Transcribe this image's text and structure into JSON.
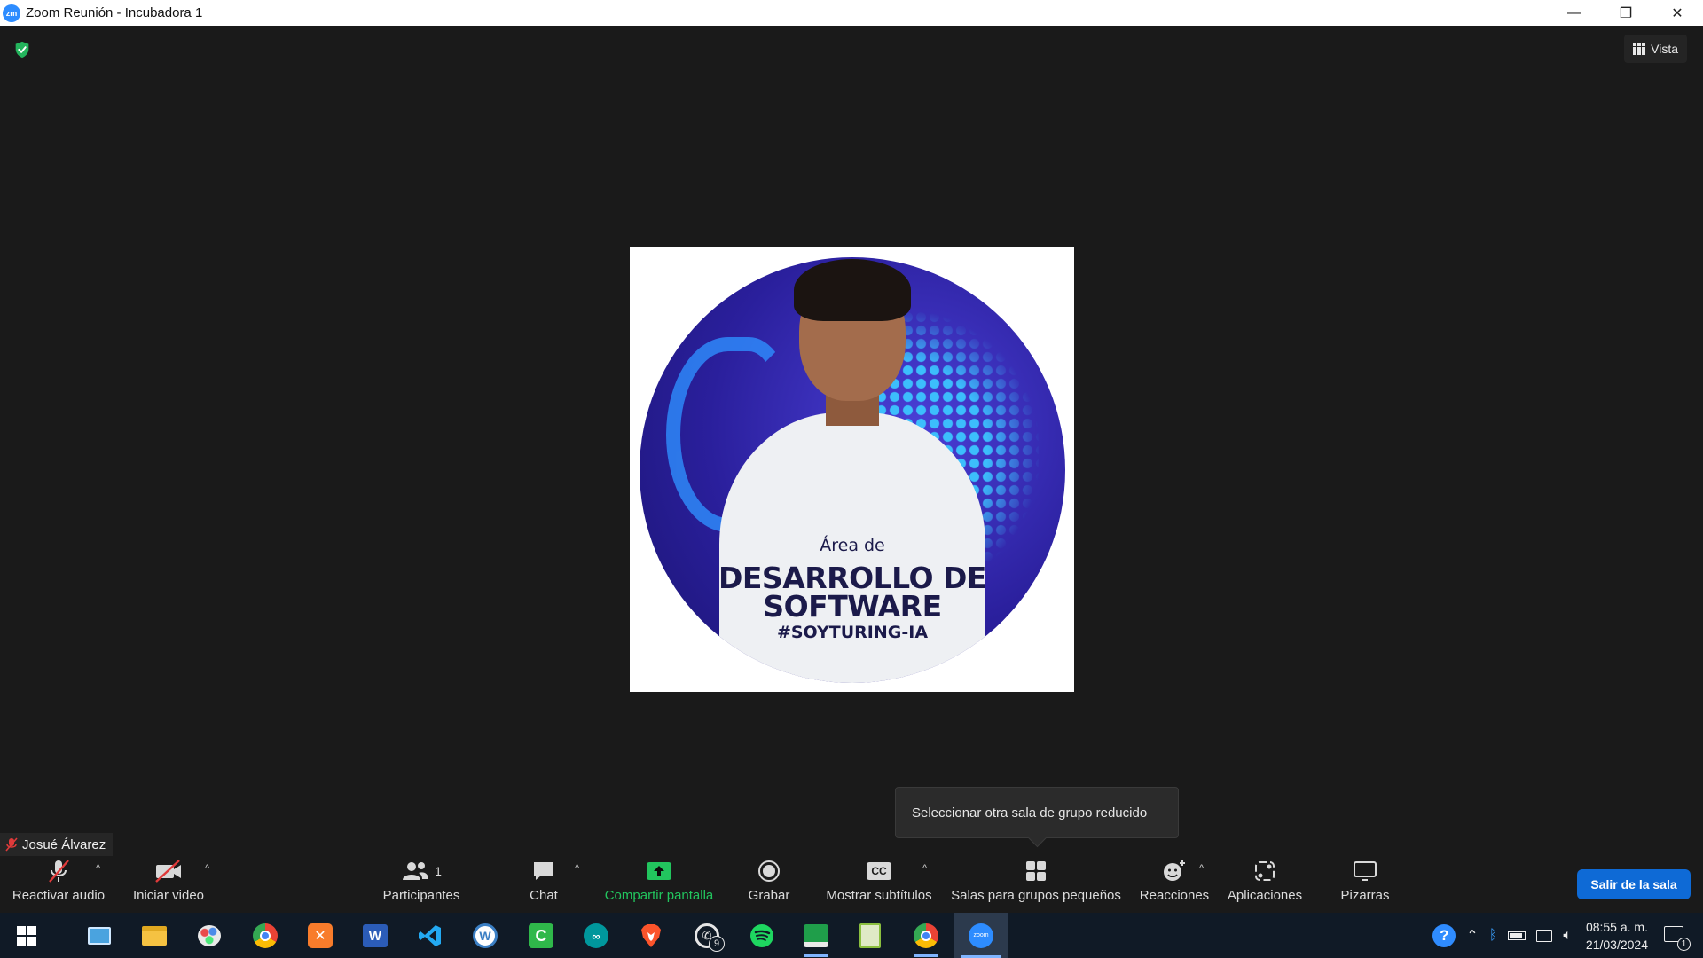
{
  "window": {
    "title": "Zoom Reunión - Incubadora 1",
    "logo_text": "zm",
    "minimize": "—",
    "restore": "❐",
    "close": "✕"
  },
  "meeting": {
    "view_label": "Vista",
    "participant_name": "Josué Álvarez",
    "avatar_text": {
      "line1": "Área de",
      "line2": "DESARROLLO DE",
      "line3": "SOFTWARE",
      "line4": "#SOYTURING-IA"
    },
    "tooltip": "Seleccionar otra sala de grupo reducido"
  },
  "toolbar": {
    "mute": "Reactivar audio",
    "video": "Iniciar video",
    "participants": "Participantes",
    "participants_count": "1",
    "chat": "Chat",
    "share": "Compartir pantalla",
    "record": "Grabar",
    "captions": "Mostrar subtítulos",
    "captions_icon": "CC",
    "breakout": "Salas para grupos pequeños",
    "reactions": "Reacciones",
    "apps": "Aplicaciones",
    "whiteboards": "Pizarras",
    "leave": "Salir de la sala",
    "caret": "^"
  },
  "taskbar": {
    "apps": [
      "windows-start",
      "control-panel",
      "file-explorer",
      "paint",
      "chrome",
      "xampp",
      "word",
      "vscode",
      "wordpress",
      "camtasia",
      "arduino",
      "brave",
      "whatsapp",
      "spotify",
      "app-green",
      "notepad-plus",
      "chrome-profile",
      "zoom"
    ],
    "whatsapp_badge": "9",
    "time": "08:55 a. m.",
    "date": "21/03/2024",
    "notification_count": "1"
  },
  "colors": {
    "accent_green": "#22c55e",
    "leave_blue": "#0e6ad6",
    "zoom_blue": "#2d8cff"
  }
}
